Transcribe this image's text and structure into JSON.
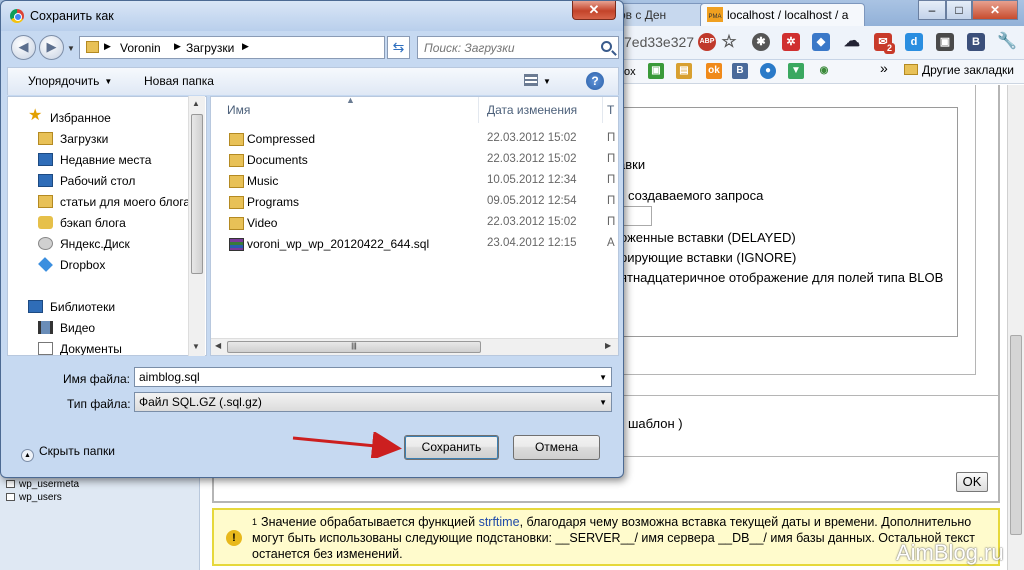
{
  "browser": {
    "tabs": [
      {
        "label": "",
        "active": false
      },
      {
        "label": "",
        "active": false
      },
      {
        "label": "ов с Ден",
        "active": false
      },
      {
        "label": "localhost / localhost / а",
        "active": true
      }
    ],
    "url_fragment": "7ed33e327",
    "extensions": [
      "abp-icon",
      "star-icon",
      "bug-icon",
      "red-ext-icon",
      "blue-ext-icon",
      "cloud-icon",
      "mail-icon",
      "d-icon",
      "puzzle-icon",
      "b-icon",
      "wrench-icon"
    ],
    "mail_badge": "2",
    "bookmarks_fragment": "ox",
    "bookmarks_chevron": "»",
    "other_bookmarks": "Другие закладки",
    "window_buttons": {
      "minimize": "–",
      "maximize": "□",
      "close": "✕"
    }
  },
  "page": {
    "nav_tables": [
      "wp_usermeta",
      "wp_users"
    ],
    "options": [
      {
        "text": "авки"
      },
      {
        "text": "создаваемого запроса"
      },
      {
        "text": "оженные вставки (DELAYED)"
      },
      {
        "text": "рирующие вставки (IGNORE)"
      },
      {
        "text": "ятнадцатеричное отображение для полей типа BLOB"
      }
    ],
    "template_fragment": "шаблон )",
    "ok_label": "OK",
    "footnote": {
      "sup": "1",
      "text_before": "Значение обрабатывается функцией ",
      "link": "strftime",
      "text_after": ", благодаря чему возможна вставка текущей даты и времени. Дополнительно могут быть использованы следующие подстановки: __SERVER__/ имя сервера __DB__/ имя базы данных. Остальной текст останется без изменений."
    },
    "watermark": "AimBlog.ru"
  },
  "dialog": {
    "title": "Сохранить как",
    "close": "✕",
    "back_icon": "back-arrow-icon",
    "path": [
      "Voronin",
      "Загрузки"
    ],
    "search_placeholder": "Поиск: Загрузки",
    "toolbar": {
      "organize": "Упорядочить",
      "new_folder": "Новая папка"
    },
    "nav_favorites_header": "Избранное",
    "nav_favorites": [
      {
        "label": "Загрузки",
        "icon": "folder"
      },
      {
        "label": "Недавние места",
        "icon": "recent"
      },
      {
        "label": "Рабочий стол",
        "icon": "desktop"
      },
      {
        "label": "статьи для моего блога",
        "icon": "folder"
      },
      {
        "label": "бэкап блога",
        "icon": "key"
      },
      {
        "label": "Яндекс.Диск",
        "icon": "yandex"
      },
      {
        "label": "Dropbox",
        "icon": "dropbox"
      }
    ],
    "nav_libraries_header": "Библиотеки",
    "nav_libraries": [
      {
        "label": "Видео",
        "icon": "film"
      },
      {
        "label": "Документы",
        "icon": "doc"
      }
    ],
    "columns": {
      "name": "Имя",
      "date": "Дата изменения",
      "type": "Т"
    },
    "files": [
      {
        "name": "Compressed",
        "date": "22.03.2012 15:02",
        "type": "П",
        "icon": "folder"
      },
      {
        "name": "Documents",
        "date": "22.03.2012 15:02",
        "type": "П",
        "icon": "folder"
      },
      {
        "name": "Music",
        "date": "10.05.2012 12:34",
        "type": "П",
        "icon": "folder"
      },
      {
        "name": "Programs",
        "date": "09.05.2012 12:54",
        "type": "П",
        "icon": "folder"
      },
      {
        "name": "Video",
        "date": "22.03.2012 15:02",
        "type": "П",
        "icon": "folder"
      },
      {
        "name": "voroni_wp_wp_20120422_644.sql",
        "date": "23.04.2012 12:15",
        "type": "А",
        "icon": "archive"
      }
    ],
    "filename_label": "Имя файла:",
    "filename_value": "aimblog.sql",
    "filetype_label": "Тип файла:",
    "filetype_value": "Файл SQL.GZ (.sql.gz)",
    "hide_folders": "Скрыть папки",
    "save_label": "Сохранить",
    "cancel_label": "Отмена"
  }
}
